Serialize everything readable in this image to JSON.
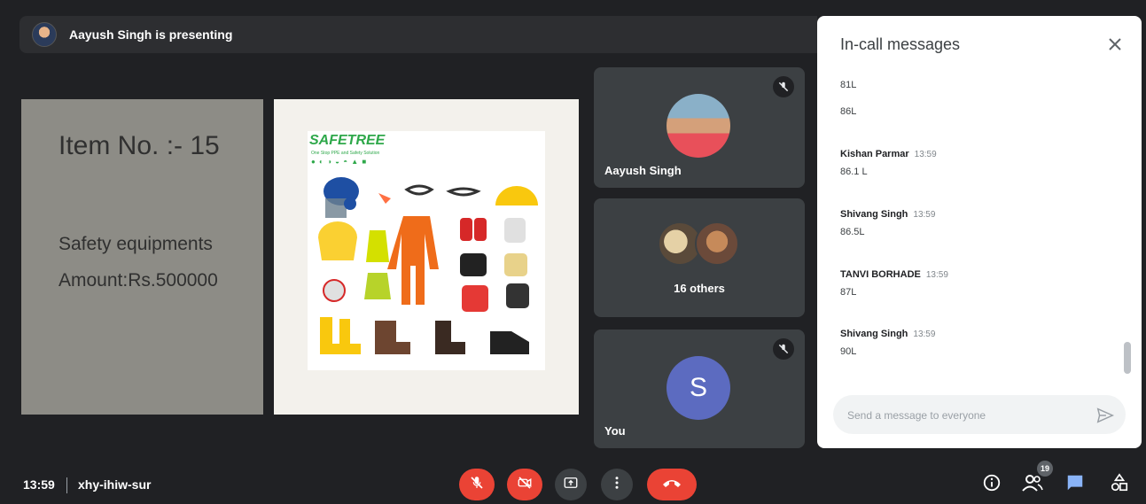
{
  "presenting": {
    "text": "Aayush Singh is presenting"
  },
  "slide": {
    "item_no": "Item No. :- 15",
    "subtitle": "Safety equipments",
    "amount": "Amount:Rs.500000",
    "catalog_brand": "SAFETREE",
    "catalog_tagline": "One Stop PPE and Safety Solution"
  },
  "participants": {
    "presenter": {
      "name": "Aayush Singh",
      "muted": true
    },
    "others": {
      "label": "16 others"
    },
    "you": {
      "name": "You",
      "initial": "S",
      "muted": true,
      "avatar_color": "#5c6bc0"
    }
  },
  "chat": {
    "title": "In-call messages",
    "messages": [
      {
        "sender": "",
        "time": "",
        "text": "81L"
      },
      {
        "sender": "",
        "time": "",
        "text": "86L"
      },
      {
        "sender": "Kishan Parmar",
        "time": "13:59",
        "text": "86.1 L"
      },
      {
        "sender": "Shivang Singh",
        "time": "13:59",
        "text": "86.5L"
      },
      {
        "sender": "TANVI BORHADE",
        "time": "13:59",
        "text": "87L"
      },
      {
        "sender": "Shivang Singh",
        "time": "13:59",
        "text": "90L"
      }
    ],
    "input_placeholder": "Send a message to everyone"
  },
  "meeting": {
    "time": "13:59",
    "code": "xhy-ihiw-sur"
  },
  "controls": {
    "mic": "mic-off-icon",
    "camera": "camera-off-icon",
    "present": "present-screen-icon",
    "more": "more-options-icon",
    "leave": "end-call-icon"
  },
  "right_controls": {
    "people_count": "19"
  },
  "colors": {
    "danger": "#ea4335",
    "chat_active": "#8ab4f8",
    "background": "#202124"
  }
}
